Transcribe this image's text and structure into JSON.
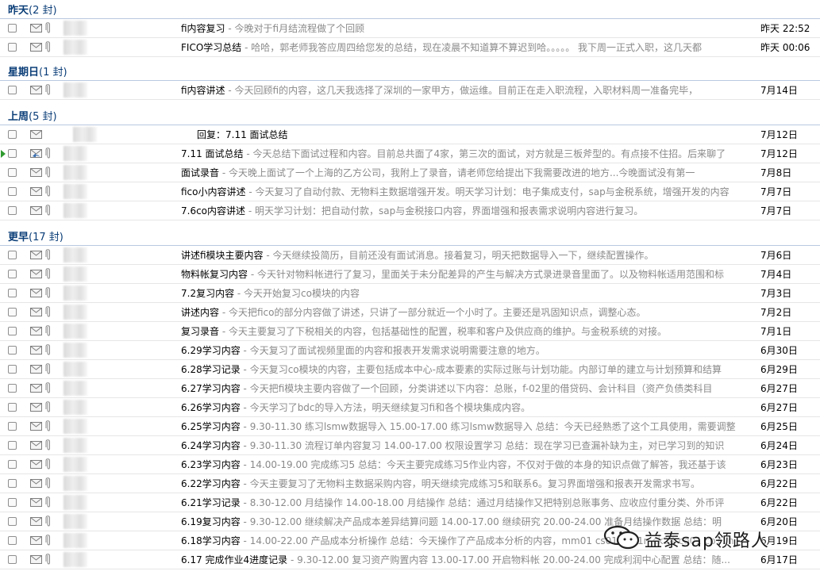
{
  "groups": [
    {
      "title": "昨天",
      "count": "(2 封)"
    },
    {
      "title": "星期日",
      "count": "(1 封)"
    },
    {
      "title": "上周",
      "count": "(5 封)"
    },
    {
      "title": "更早",
      "count": "(17 封)"
    }
  ],
  "rows": [
    {
      "subject": "fi内容复习",
      "snippet": " - 今晚对于fi月结流程做了个回顾",
      "date": "昨天 22:52"
    },
    {
      "subject": "FICO学习总结",
      "snippet": " - 哈哈，郭老师我答应周四给您发的总结，现在凌晨不知道算不算迟到哈。。。。。 我下周一正式入职，这几天都",
      "date": "昨天 00:06"
    },
    {
      "subject": "fi内容讲述",
      "snippet": " - 今天回顾fi的内容，这几天我选择了深圳的一家甲方，做运维。目前正在走入职流程，入职材料周一准备完毕，",
      "date": "7月14日"
    },
    {
      "subject": "回复：7.11 面试总结",
      "snippet": "",
      "date": "7月12日"
    },
    {
      "subject": "7.11 面试总结",
      "snippet": " - 今天总结下面试过程和内容。目前总共面了4家，第三次的面试，对方就是三板斧型的。有点接不住招。后来聊了",
      "date": "7月12日"
    },
    {
      "subject": "面试录音",
      "snippet": " - 今天晚上面试了一个上海的乙方公司，我附上了录音，请老师您给提出下我需要改进的地方...今晚面试没有第一",
      "date": "7月8日"
    },
    {
      "subject": "fico小内容讲述",
      "snippet": " - 今天复习了自动付款、无物料主数据增强开发。明天学习计划：电子集成支付，sap与金税系统，增强开发的内容",
      "date": "7月7日"
    },
    {
      "subject": "7.6co内容讲述",
      "snippet": " - 明天学习计划：把自动付款，sap与金税接口内容，界面增强和报表需求说明内容进行复习。",
      "date": "7月7日"
    },
    {
      "subject": "讲述fi模块主要内容",
      "snippet": " - 今天继续投简历，目前还没有面试消息。接着复习，明天把数据导入一下，继续配置操作。",
      "date": "7月6日"
    },
    {
      "subject": "物料帐复习内容",
      "snippet": " - 今天针对物料帐进行了复习，里面关于未分配差异的产生与解决方式录进录音里面了。以及物料帐适用范围和标",
      "date": "7月4日"
    },
    {
      "subject": "7.2复习内容",
      "snippet": " - 今天开始复习co模块的内容",
      "date": "7月3日"
    },
    {
      "subject": "讲述内容",
      "snippet": " - 今天把fico的部分内容做了讲述，只讲了一部分就近一个小时了。主要还是巩固知识点，调整心态。",
      "date": "7月2日"
    },
    {
      "subject": "复习录音",
      "snippet": " - 今天主要复习了下税相关的内容，包括基础性的配置，税率和客户及供应商的维护。与金税系统的对接。",
      "date": "7月1日"
    },
    {
      "subject": "6.29学习内容",
      "snippet": " - 今天复习了面试视频里面的内容和报表开发需求说明需要注意的地方。",
      "date": "6月30日"
    },
    {
      "subject": "6.28学习记录",
      "snippet": " - 今天复习co模块的内容，主要包括成本中心-成本要素的实际过账与计划功能。内部订单的建立与计划预算和结算",
      "date": "6月29日"
    },
    {
      "subject": "6.27学习内容",
      "snippet": " - 今天把fi模块主要内容做了一个回顾，分类讲述以下内容：总账，f-02里的借贷码、会计科目（资产负债类科目",
      "date": "6月27日"
    },
    {
      "subject": "6.26学习内容",
      "snippet": " - 今天学习了bdc的导入方法，明天继续复习fi和各个模块集成内容。",
      "date": "6月27日"
    },
    {
      "subject": "6.25学习内容",
      "snippet": " - 9.30-11.30 练习lsmw数据导入 15.00-17.00 练习lsmw数据导入 总结：今天已经熟悉了这个工具使用，需要调整",
      "date": "6月25日"
    },
    {
      "subject": "6.24学习内容",
      "snippet": " - 9.30-11.30 流程订单内容复习 14.00-17.00 权限设置学习 总结：现在学习已查漏补缺为主，对已学习到的知识",
      "date": "6月24日"
    },
    {
      "subject": "6.23学习内容",
      "snippet": " - 14.00-19.00 完成练习5 总结：今天主要完成练习5作业内容，不仅对于做的本身的知识点做了解答，我还基于该",
      "date": "6月23日"
    },
    {
      "subject": "6.22学习内容",
      "snippet": " - 今天主要复习了无物料主数据采购内容，明天继续完成练习5和联系6。复习界面增强和报表开发需求书写。",
      "date": "6月22日"
    },
    {
      "subject": "6.21学习记录",
      "snippet": " - 8.30-12.00 月结操作 14.00-18.00 月结操作 总结：通过月结操作又把特别总账事务、应收应付重分类、外币评",
      "date": "6月22日"
    },
    {
      "subject": "6.19复习内容",
      "snippet": " - 9.30-12.00 继续解决产品成本差异结算问题 14.00-17.00 继续研究 20.00-24.00 准备月结操作数据 总结：明",
      "date": "6月20日"
    },
    {
      "subject": "6.18学习内容",
      "snippet": " - 14.00-22.00 产品成本分析操作 总结：今天操作了产品成本分析的内容，mm01 cs01 ck11n ck24 co01 co11n",
      "date": "6月19日"
    },
    {
      "subject": "6.17 完成作业4进度记录",
      "snippet": " - 9.30-12.00 复习资产购置内容 13.00-17.00 开启物料帐 20.00-24.00 完成利润中心配置 总结：随...",
      "date": "6月17日"
    }
  ],
  "watermark": {
    "text": "益泰sap领路人"
  },
  "colors": {
    "group_header": "#0b3e78",
    "snippet": "#8a8a8a",
    "unread_flag": "#2f9b2f"
  }
}
